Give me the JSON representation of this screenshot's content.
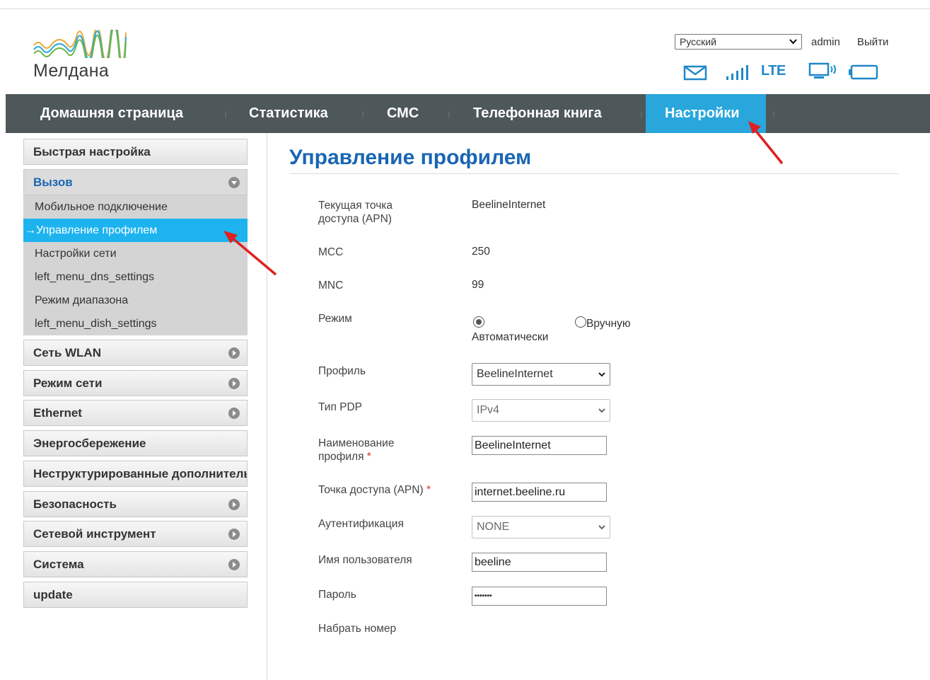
{
  "header": {
    "brand_name": "Мелдана",
    "language": "Русский",
    "user": "admin",
    "logout": "Выйти",
    "network_type": "LTE",
    "icons": [
      "mail-icon",
      "signal-icon",
      "lte-indicator",
      "device-connection-icon",
      "battery-icon"
    ]
  },
  "nav": {
    "items": [
      {
        "label": "Домашняя страница"
      },
      {
        "label": "Статистика"
      },
      {
        "label": "СМС"
      },
      {
        "label": "Телефонная книга"
      },
      {
        "label": "Настройки",
        "active": true
      }
    ]
  },
  "sidebar": {
    "quick_setup": "Быстрая настройка",
    "call": "Вызов",
    "call_submenu": [
      {
        "label": "Мобильное подключение"
      },
      {
        "label": "→Управление профилем",
        "active": true
      },
      {
        "label": "Настройки сети"
      },
      {
        "label": "left_menu_dns_settings"
      },
      {
        "label": "Режим диапазона"
      },
      {
        "label": "left_menu_dish_settings"
      }
    ],
    "wlan": "Сеть WLAN",
    "network_mode": "Режим сети",
    "ethernet": "Ethernet",
    "power_saving": "Энергосбережение",
    "unstructured": "Неструктурированные дополнительные",
    "security": "Безопасность",
    "network_tool": "Сетевой инструмент",
    "system": "Система",
    "update": "update"
  },
  "main": {
    "title": "Управление профилем",
    "current_apn_label": "Текущая точка доступа (APN)",
    "current_apn": "BeelineInternet",
    "mcc_label": "MCC",
    "mcc": "250",
    "mnc_label": "MNC",
    "mnc": "99",
    "mode_label": "Режим",
    "mode_auto": "Автоматически",
    "mode_manual": "Вручную",
    "mode_selected": "auto",
    "profile_label": "Профиль",
    "profile_value": "BeelineInternet",
    "pdp_label": "Тип PDP",
    "pdp_value": "IPv4",
    "profile_name_label": "Наименование профиля",
    "profile_name_value": "BeelineInternet",
    "apn_label": "Точка доступа (APN)",
    "apn_value": "internet.beeline.ru",
    "auth_label": "Аутентификация",
    "auth_value": "NONE",
    "username_label": "Имя пользователя",
    "username_value": "beeline",
    "password_label": "Пароль",
    "password_value": "•••••••",
    "dial_label": "Набрать номер",
    "required_mark": "*"
  },
  "colors": {
    "nav_bg": "#4e575a",
    "nav_active": "#29a6dc",
    "submenu_active": "#1db3ef",
    "title_blue": "#1a66b3",
    "annotation_arrow": "#e02020"
  }
}
